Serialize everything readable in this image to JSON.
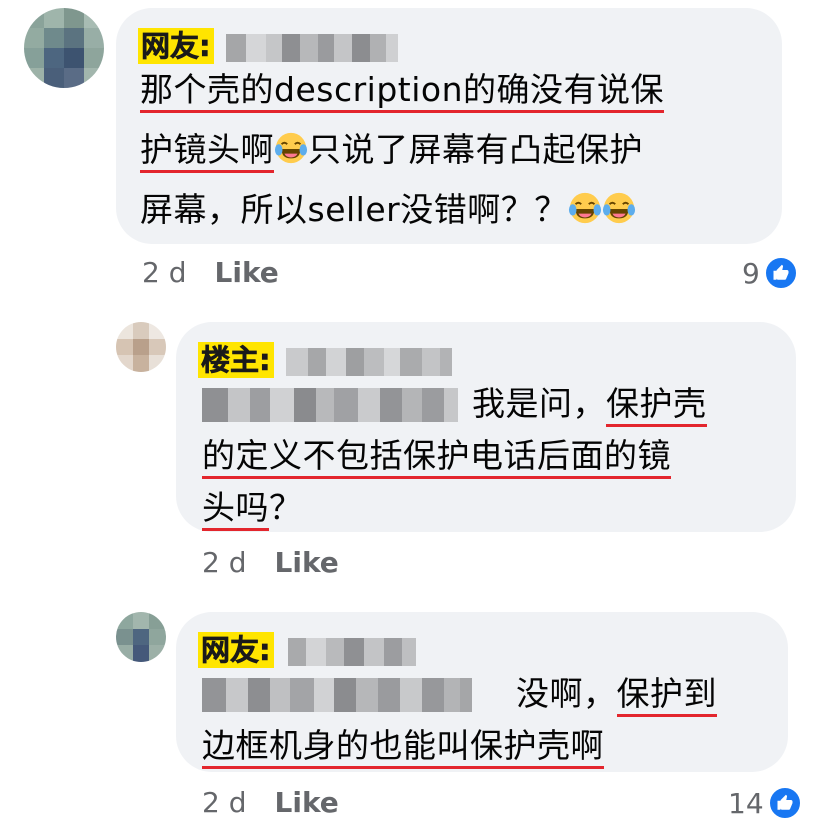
{
  "comments": [
    {
      "badge": "网友:",
      "lines": [
        {
          "parts": [
            {
              "t": "那个壳的description的确没有说保",
              "ul": true
            }
          ]
        },
        {
          "parts": [
            {
              "t": "护镜头啊",
              "ul": true
            },
            {
              "emoji": "😂"
            },
            {
              "t": "只说了屏幕有凸起保护",
              "ul": false
            }
          ]
        },
        {
          "parts": [
            {
              "t": "屏幕，所以seller没错啊？？",
              "ul": false
            },
            {
              "emoji": "😂"
            },
            {
              "emoji": "😂"
            }
          ]
        }
      ],
      "time": "2 d",
      "like": "Like",
      "reactions": "9"
    },
    {
      "badge": "楼主:",
      "lines": [
        {
          "parts": [
            {
              "t": "我是问，",
              "ul": false
            },
            {
              "t": "保护壳",
              "ul": true
            }
          ]
        },
        {
          "parts": [
            {
              "t": "的定义不包括保护电话后面的镜",
              "ul": true
            }
          ]
        },
        {
          "parts": [
            {
              "t": "头吗",
              "ul": true
            },
            {
              "t": "？",
              "ul": false
            }
          ]
        }
      ],
      "time": "2 d",
      "like": "Like"
    },
    {
      "badge": "网友:",
      "lines": [
        {
          "parts": [
            {
              "t": "没啊，",
              "ul": false
            },
            {
              "t": "保护到",
              "ul": true
            }
          ]
        },
        {
          "parts": [
            {
              "t": "边框机身的也能叫保护壳啊",
              "ul": true
            }
          ]
        }
      ],
      "time": "2 d",
      "like": "Like",
      "reactions": "14"
    }
  ],
  "colors": {
    "bubble": "#f0f2f5",
    "badge": "#ffe500",
    "underline": "#e3262d",
    "like_blue": "#1877f2",
    "meta_text": "#65676b"
  },
  "icons": [
    "avatar-pixelated",
    "thumbs-up-reaction-icon",
    "laughing-tears-emoji"
  ]
}
